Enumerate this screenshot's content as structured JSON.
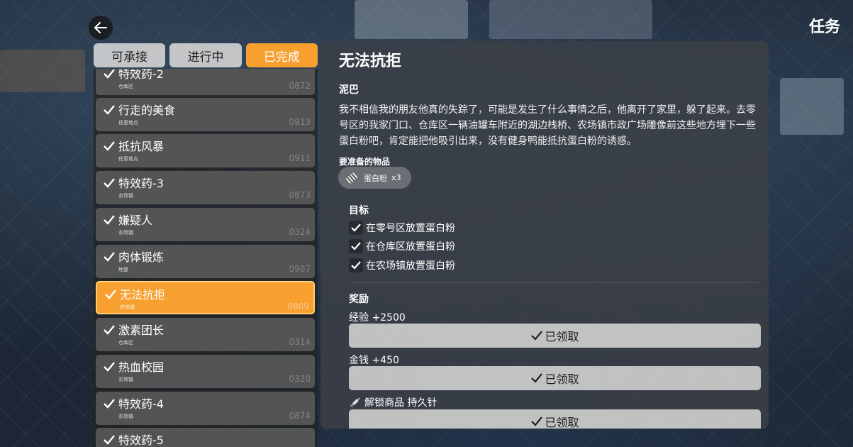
{
  "header": {
    "title": "任务"
  },
  "tabs": [
    {
      "label": "可承接",
      "active": false
    },
    {
      "label": "进行中",
      "active": false
    },
    {
      "label": "已完成",
      "active": true
    }
  ],
  "quests": [
    {
      "name": "特效药-2",
      "location": "仓库区",
      "code": "0872",
      "selected": false
    },
    {
      "name": "行走的美食",
      "location": "任意地点",
      "code": "0913",
      "selected": false
    },
    {
      "name": "抵抗风暴",
      "location": "任意地点",
      "code": "0911",
      "selected": false
    },
    {
      "name": "特效药-3",
      "location": "农场镇",
      "code": "0873",
      "selected": false
    },
    {
      "name": "嫌疑人",
      "location": "农场镇",
      "code": "0324",
      "selected": false
    },
    {
      "name": "肉体锻炼",
      "location": "地堡",
      "code": "0907",
      "selected": false
    },
    {
      "name": "无法抗拒",
      "location": "农场镇",
      "code": "0809",
      "selected": true
    },
    {
      "name": "激素团长",
      "location": "仓库区",
      "code": "0314",
      "selected": false
    },
    {
      "name": "热血校园",
      "location": "农场镇",
      "code": "0320",
      "selected": false
    },
    {
      "name": "特效药-4",
      "location": "农场镇",
      "code": "0874",
      "selected": false
    },
    {
      "name": "特效药-5",
      "location": "",
      "code": "",
      "selected": false
    }
  ],
  "detail": {
    "title": "无法抗拒",
    "giver": "泥巴",
    "description": "我不相信我的朋友他真的失踪了，可能是发生了什么事情之后，他离开了家里，躲了起来。去零号区的我家门口、仓库区一辆油罐车附近的湖边栈桥、农场镇市政广场雕像前这些地方埋下一些蛋白粉吧，肯定能把他吸引出来，没有健身鸭能抵抗蛋白粉的诱惑。",
    "required_label": "要准备的物品",
    "required_item": {
      "name": "蛋白粉",
      "qty": "x3",
      "icon": "protein-powder-icon"
    },
    "goals_label": "目标",
    "goals": [
      {
        "text": "在零号区放置蛋白粉",
        "done": true
      },
      {
        "text": "在仓库区放置蛋白粉",
        "done": true
      },
      {
        "text": "在农场镇放置蛋白粉",
        "done": true
      }
    ],
    "rewards_label": "奖励",
    "rewards": [
      {
        "label": "经验 +2500",
        "button": "已领取",
        "icon": ""
      },
      {
        "label": "金钱 +450",
        "button": "已领取",
        "icon": ""
      },
      {
        "label": "解锁商品 持久针",
        "button": "已领取",
        "icon": "syringe-icon"
      }
    ]
  },
  "colors": {
    "accent": "#f7a030",
    "panel": "#3c3f46",
    "tab": "#d7d7d7"
  }
}
